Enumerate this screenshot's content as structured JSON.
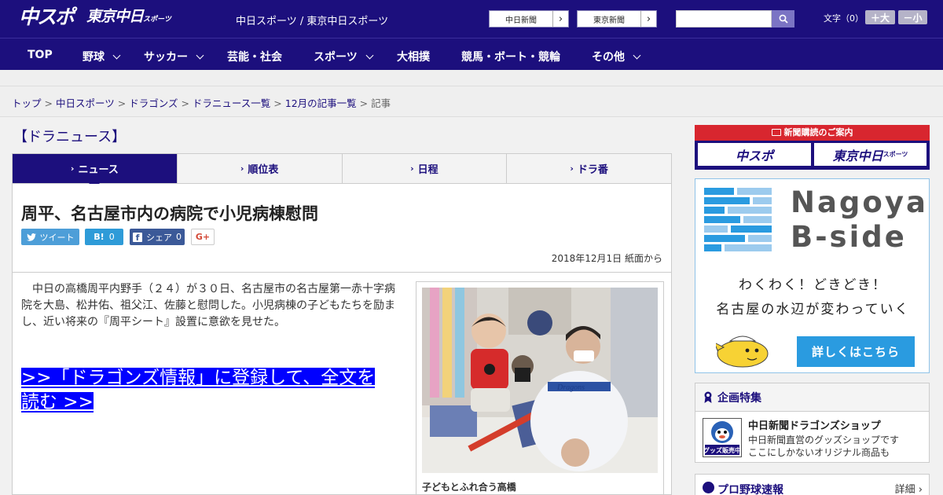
{
  "header": {
    "logo_chuspo": "中スポ",
    "logo_tokyo_chunichi": "東京中日",
    "logo_sports_small": "スポーツ",
    "site_name": "中日スポーツ / 東京中日スポーツ",
    "paper_links": [
      "中日新聞",
      "東京新聞"
    ],
    "search_placeholder": "",
    "font_size_label": "文字（0）",
    "font_bigger": "＋大",
    "font_smaller": "－小"
  },
  "nav": [
    {
      "label": "TOP",
      "has_menu": false
    },
    {
      "label": "野球",
      "has_menu": true
    },
    {
      "label": "サッカー",
      "has_menu": true
    },
    {
      "label": "芸能・社会",
      "has_menu": false
    },
    {
      "label": "スポーツ",
      "has_menu": true
    },
    {
      "label": "大相撲",
      "has_menu": false
    },
    {
      "label": "競馬・ボート・競輪",
      "has_menu": false
    },
    {
      "label": "その他",
      "has_menu": true
    }
  ],
  "breadcrumb": {
    "links": [
      "トップ",
      "中日スポーツ",
      "ドラゴンズ",
      "ドラニュース一覧",
      "12月の記事一覧"
    ],
    "separator": ">",
    "current": "記事"
  },
  "section_title": "【ドラニュース】",
  "tabs": [
    {
      "label": "ニュース",
      "active": true
    },
    {
      "label": "順位表",
      "active": false
    },
    {
      "label": "日程",
      "active": false
    },
    {
      "label": "ドラ番",
      "active": false
    }
  ],
  "article": {
    "headline": "周平、名古屋市内の病院で小児病棟慰問",
    "share": {
      "tweet": "ツイート",
      "hatena_label": "B!",
      "hatena_count": "0",
      "facebook": "シェア",
      "facebook_count": "0",
      "gplus": "G+"
    },
    "date": "2018年12月1日 紙面から",
    "body": "中日の高橋周平内野手（２４）が３０日、名古屋市の名古屋第一赤十字病院を大島、松井佑、祖父江、佐藤と慰問した。小児病棟の子どもたちを励まし、近い将来の『周平シート』設置に意欲を見せた。",
    "cta": ">>「ドラゴンズ情報」に登録して、全文を読む >>",
    "photo_caption": "子どもとふれ合う高橋",
    "photo_jersey_text": "Dragons"
  },
  "sidebar": {
    "subscribe_header": "新聞購読のご案内",
    "subscribe_chuspo": "中スポ",
    "subscribe_tokyo": "東京中日",
    "subscribe_tokyo_small": "スポーツ",
    "bside_title_1": "Nagoya",
    "bside_title_2": "B-side",
    "bside_line_1": "わくわく！どきどき！",
    "bside_line_2": "名古屋の水辺が変わっていく",
    "bside_button": "詳しくはこちら",
    "features_title": "企画特集",
    "shop_title": "中日新聞ドラゴンズショップ",
    "shop_desc_1": "中日新聞直営のグッズショップです",
    "shop_desc_2": "ここにしかないオリジナル商品も",
    "shop_badge": "グッズ販売中",
    "pro_baseball_title": "プロ野球速報",
    "pro_baseball_detail": "詳細 ›"
  },
  "colors": {
    "brand_navy": "#1c0f7d",
    "cta_blue": "#0000ff",
    "bside_blue": "#2a9be0",
    "subscribe_red": "#d8262f"
  }
}
